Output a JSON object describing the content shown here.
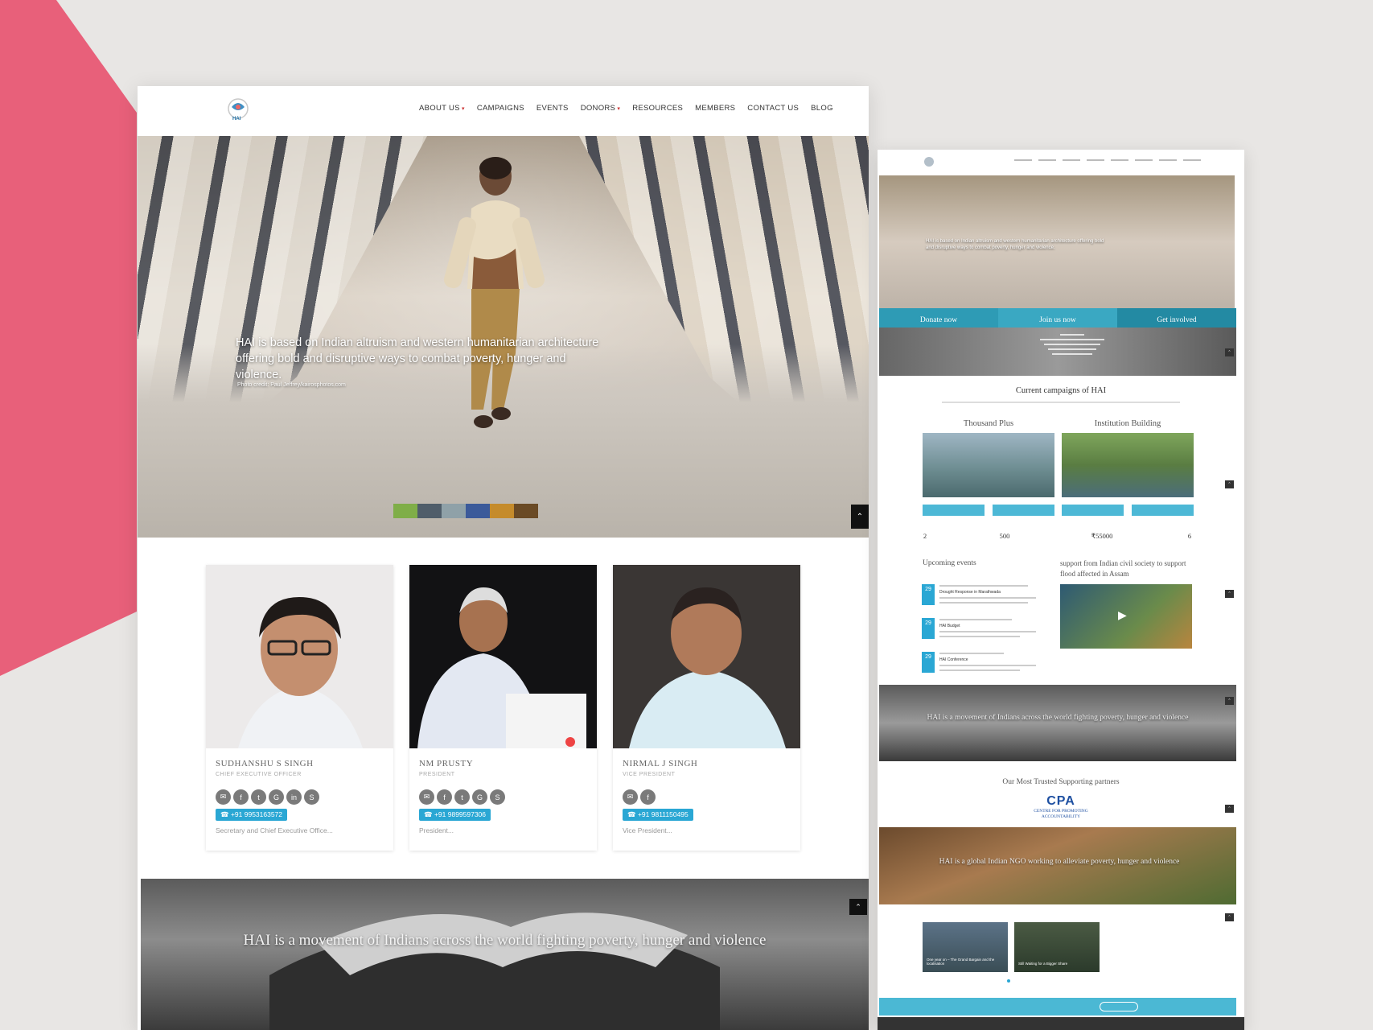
{
  "desktop": {
    "logo_text": "HAI",
    "nav": [
      {
        "label": "ABOUT US",
        "caret": true
      },
      {
        "label": "CAMPAIGNS",
        "caret": false
      },
      {
        "label": "EVENTS",
        "caret": false
      },
      {
        "label": "DONORS",
        "caret": true
      },
      {
        "label": "RESOURCES",
        "caret": false
      },
      {
        "label": "MEMBERS",
        "caret": false
      },
      {
        "label": "CONTACT US",
        "caret": false
      },
      {
        "label": "BLOG",
        "caret": false
      }
    ],
    "hero": {
      "caption": "HAI is based on Indian altruism and western humanitarian architecture offering bold and disruptive ways to combat poverty, hunger and violence.",
      "credit": "Photo credit: Paul Jeffrey/kairosphotos.com"
    },
    "team": [
      {
        "name": "SUDHANSHU S SINGH",
        "role": "CHIEF EXECUTIVE OFFICER",
        "phone": "+91 9953163572",
        "desc": "Secretary and Chief Executive Office..."
      },
      {
        "name": "NM PRUSTY",
        "role": "PRESIDENT",
        "phone": "+91 9899597306",
        "desc": "President..."
      },
      {
        "name": "NIRMAL J SINGH",
        "role": "VICE PRESIDENT",
        "phone": "+91 9811150495",
        "desc": "Vice President..."
      }
    ],
    "band_text": "HAI is a movement of Indians across the world fighting poverty, hunger and violence"
  },
  "mobile": {
    "cta": [
      "Donate now",
      "Join us now",
      "Get involved"
    ],
    "campaigns_title": "Current campaigns of HAI",
    "campaigns": [
      "Thousand Plus",
      "Institution Building"
    ],
    "stats": [
      "2",
      "500",
      "₹55000",
      "6"
    ],
    "events_title": "Upcoming events",
    "event_days": [
      "29",
      "29",
      "29"
    ],
    "events": [
      "Drought Response in Marathwada",
      "HAI Budget",
      "HAI Conference"
    ],
    "flood_title": "support from Indian civil society to support flood affected in Assam",
    "band_text": "HAI is a movement of Indians across the world fighting poverty, hunger and violence",
    "partners_title": "Our Most Trusted Supporting partners",
    "partner_logo": "CPA",
    "partner_sub": "CENTRE FOR PROMOTING ACCOUNTABILITY",
    "band2_text": "HAI is a global Indian NGO working to alleviate poverty, hunger and violence",
    "blog": [
      "One year on – The Grand Bargain and the localisation",
      "Still Waiting for a Bigger Share"
    ]
  },
  "colors": {
    "accent": "#2aa7d4",
    "pink": "#e8607a",
    "cta": "#2e9bb5"
  }
}
